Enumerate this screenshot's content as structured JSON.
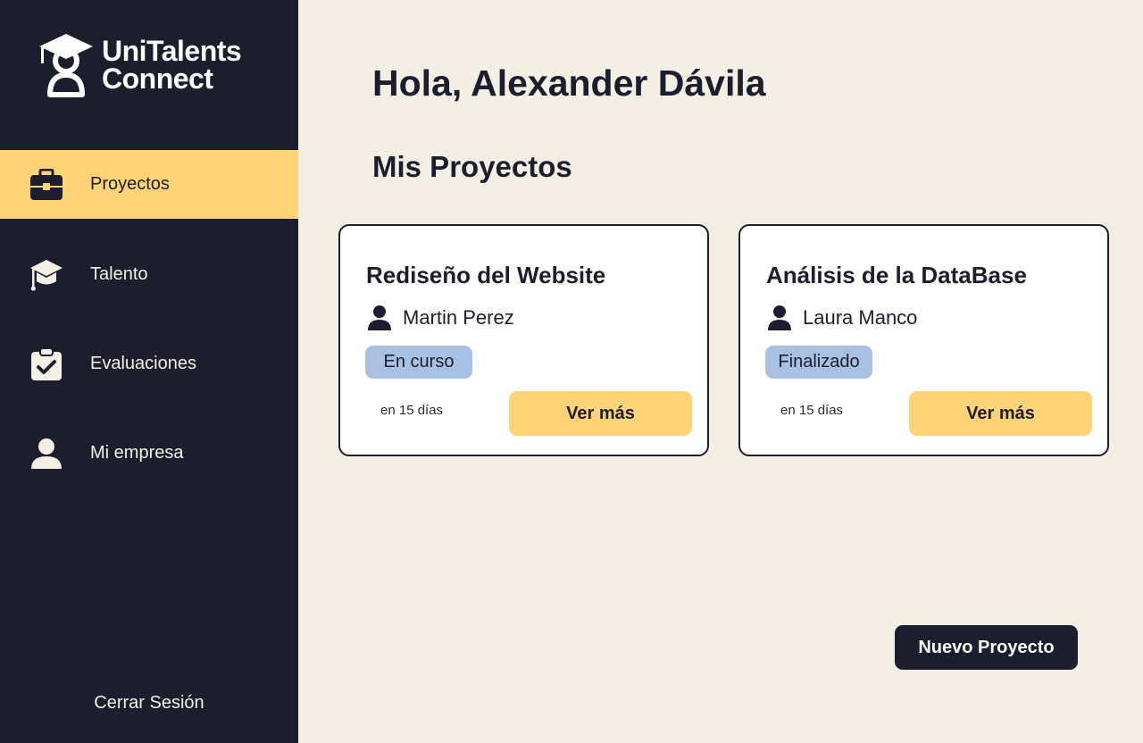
{
  "brand": {
    "line1": "UniTalents",
    "line2": "Connect",
    "logo_icon": "graduate-cap-person-icon"
  },
  "sidebar": {
    "items": [
      {
        "label": "Proyectos",
        "icon": "briefcase-icon",
        "active": true
      },
      {
        "label": "Talento",
        "icon": "graduation-cap-icon",
        "active": false
      },
      {
        "label": "Evaluaciones",
        "icon": "clipboard-check-icon",
        "active": false
      },
      {
        "label": "Mi empresa",
        "icon": "user-icon",
        "active": false
      }
    ],
    "logout_label": "Cerrar Sesión"
  },
  "main": {
    "greeting": "Hola, Alexander Dávila",
    "section_title": "Mis Proyectos",
    "projects": [
      {
        "title": "Rediseño del Website",
        "owner": "Martin Perez",
        "status": "En curso",
        "due": "en 15 días",
        "button_label": "Ver más"
      },
      {
        "title": "Análisis de la DataBase",
        "owner": "Laura Manco",
        "status": "Finalizado",
        "due": "en 15 días",
        "button_label": "Ver más"
      }
    ],
    "new_project_label": "Nuevo Proyecto"
  },
  "colors": {
    "sidebar_bg": "#1C1E2E",
    "accent": "#FFD479",
    "page_bg": "#F4EFE4",
    "status_badge": "#A8C0E2"
  }
}
